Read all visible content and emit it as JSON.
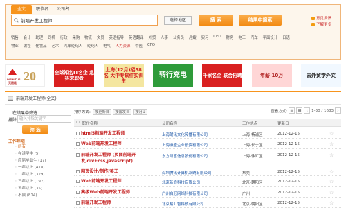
{
  "top": {
    "tabs": [
      "全文",
      "职位名",
      "公司名"
    ],
    "search_value": "前端开发工程师",
    "region_label": "选择地区",
    "search_btn": "搜 索",
    "result_search_btn": "结果中搜索",
    "feedback_link": "意见反馈",
    "help_link": "了解更多",
    "keywords_row1": [
      "销售",
      "会计",
      "助理",
      "司机",
      "行政",
      "采购",
      "物流",
      "文员",
      "英语指导",
      "英语翻译",
      "外贸",
      "人事",
      "公务员",
      "月嫂",
      "实习",
      "CEO",
      "财务",
      "电工",
      "汽车",
      "平面设计",
      "日语"
    ],
    "keywords_row2": [
      "物业",
      "编程",
      "化妆品",
      "艺术",
      "汽车经纪人",
      "经纪人",
      "电气",
      "人力资源",
      "中医",
      "CFO"
    ]
  },
  "banners": [
    {
      "text": "INFINITUS 无限极 20"
    },
    {
      "text": "20 周年"
    },
    {
      "text": "全球知名IT名企 急招求职者"
    },
    {
      "text": "上海(12月)招88名 大中专软件实训生"
    },
    {
      "text": "转行充电"
    },
    {
      "text": "千家名企 联合招聘"
    },
    {
      "text": "年薪 10万"
    },
    {
      "text": "去外贸学外文"
    }
  ],
  "crumb": {
    "label": "前端开发工程师(全文)"
  },
  "side": {
    "title": "在结果中筛选",
    "kw_label": "排除",
    "kw_placeholder": "输入排除关键字",
    "filter_btn": "筛 选",
    "section": "工作年限",
    "items": [
      "所有",
      "在读学生 (5)",
      "应届毕业生 (17)",
      "一年以上 (418)",
      "二年以上 (329)",
      "三年以上 (197)",
      "五年以上 (35)",
      "不限 (814)"
    ]
  },
  "main": {
    "sort_label": "排序方式:",
    "sort_btns": [
      "按更新日",
      "按置发日",
      "按月↓"
    ],
    "view_label": "查看方式:",
    "pager": "1-30 / 1683",
    "cols": [
      "职位名称",
      "公司名称",
      "工作地点",
      "更新日"
    ],
    "rows": [
      {
        "title": "html5前端开发工程师",
        "company": "上海朗讯文化传播有限公司",
        "loc": "上海-杨浦区",
        "date": "2012-12-15"
      },
      {
        "title": "Web前端开发工程师",
        "company": "上海谦盛企业投资有限公司",
        "loc": "上海-长宁区",
        "date": "2012-12-15"
      },
      {
        "title": "前端开发工程师 (页面前端开发,div+css,javascript)",
        "company": "东方财富信息股份有限公司",
        "loc": "上海-徐汇区",
        "date": "2012-12-15"
      },
      {
        "title": "网页设计/制作/美工",
        "company": "深圳腾讯计算机系统有限公司",
        "loc": "东莞",
        "date": "2012-12-15"
      },
      {
        "title": "Web前端开发工程师",
        "company": "北京新浪科技有限公司",
        "loc": "北京-朝阳区",
        "date": "2012-12-15"
      },
      {
        "title": "高级Web前端开发工程师",
        "company": "广州启冠网络科技有限公司",
        "loc": "广州",
        "date": "2012-12-15"
      },
      {
        "title": "前端开发工程师",
        "company": "北京易汇智科技有限公司",
        "loc": "北京-朝阳区",
        "date": "2012-12-15"
      }
    ]
  }
}
